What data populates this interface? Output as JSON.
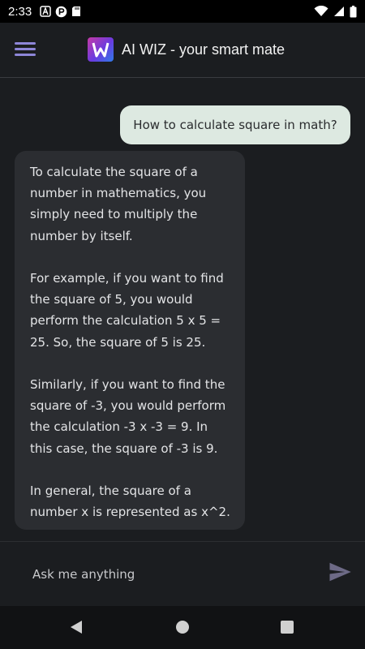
{
  "status": {
    "time": "2:33",
    "left_icons": [
      "text-a-icon",
      "app-p-icon",
      "sd-card-icon"
    ],
    "right_icons": [
      "wifi-icon",
      "signal-icon",
      "battery-icon"
    ]
  },
  "app_bar": {
    "title": "AI WIZ - your smart mate",
    "menu_icon": "hamburger-icon",
    "logo_icon": "ai-wiz-logo"
  },
  "chat": {
    "messages": [
      {
        "role": "user",
        "text": "How to calculate square in math?"
      },
      {
        "role": "assistant",
        "paragraphs": [
          "To calculate the square of a number in mathematics, you simply need to multiply the number by itself.",
          "For example, if you want to find the square of 5, you would perform the calculation 5 x 5 = 25. So, the square of 5 is 25.",
          "Similarly, if you want to find the square of -3, you would perform the calculation -3 x -3 = 9. In this case, the square of -3 is 9.",
          "In general, the square of a number x is represented as x^2."
        ]
      }
    ]
  },
  "input": {
    "placeholder": "Ask me anything",
    "value": "",
    "send_icon": "send-icon"
  },
  "nav": {
    "icons": [
      "back-icon",
      "home-icon",
      "recents-icon"
    ]
  },
  "colors": {
    "background": "#1b1d20",
    "user_bubble": "#dde9e1",
    "bot_bubble": "#2b2d31",
    "accent": "#8e86d8"
  }
}
